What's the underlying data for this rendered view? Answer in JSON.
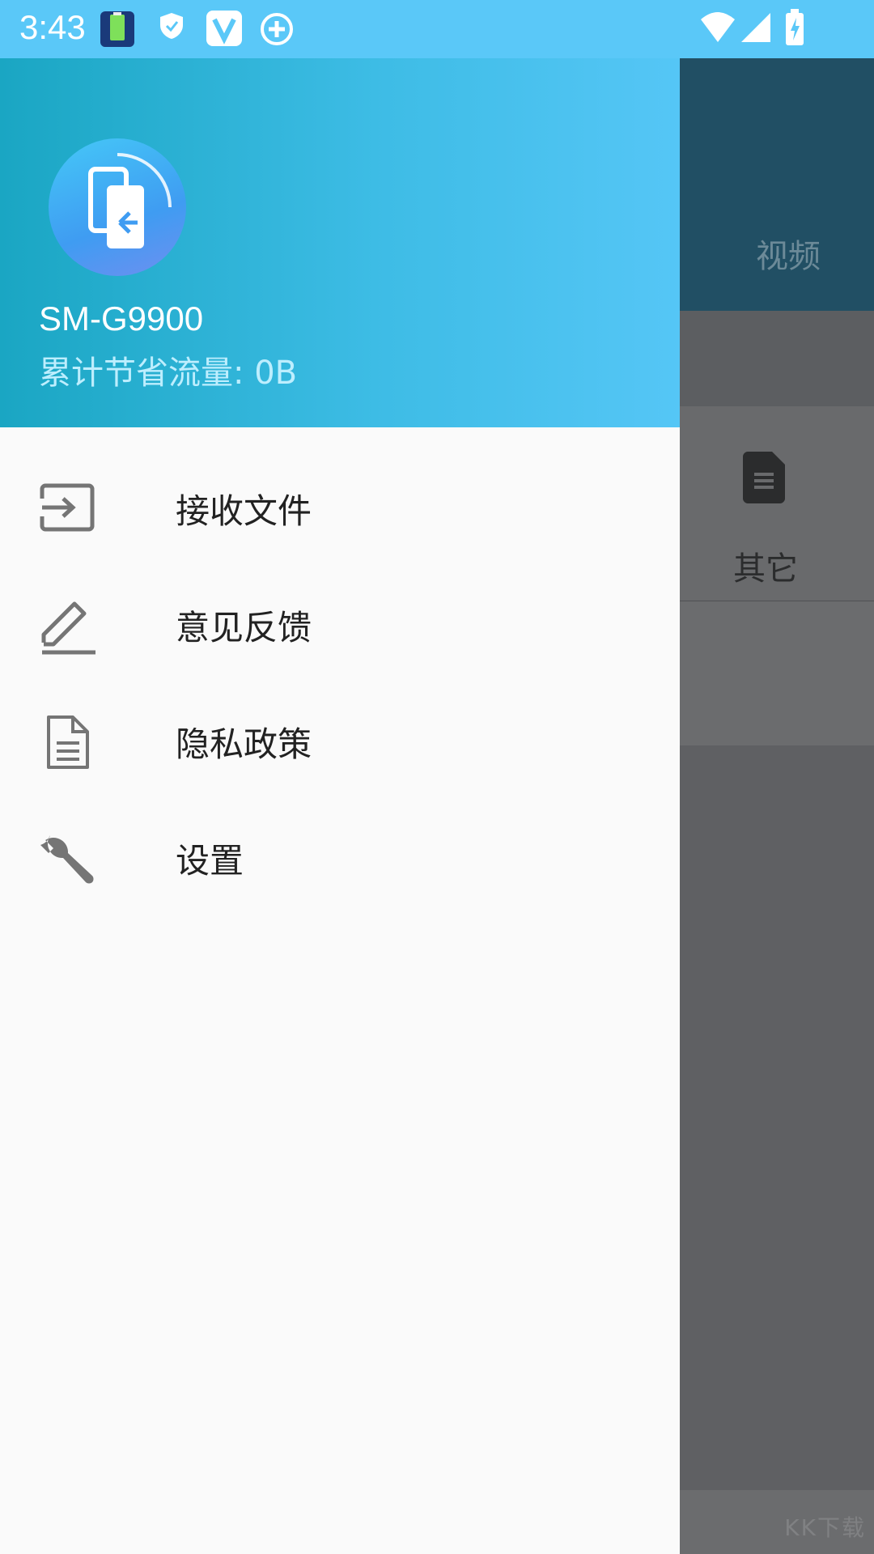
{
  "status_bar": {
    "time": "3:43",
    "left_icons": [
      "battery-app-icon",
      "shield-icon",
      "vivo-v-icon",
      "add-circle-icon"
    ],
    "right_icons": [
      "wifi-icon",
      "signal-icon",
      "battery-charging-icon"
    ]
  },
  "background_app": {
    "tab_label": "视频",
    "category_label": "其它",
    "category_icon": "document-icon",
    "watermark": "KK下载"
  },
  "drawer": {
    "device_name": "SM-G9900",
    "saved_traffic": "累计节省流量: 0B",
    "menu": [
      {
        "label": "接收文件",
        "icon": "receive-file-icon"
      },
      {
        "label": "意见反馈",
        "icon": "edit-pen-icon"
      },
      {
        "label": "隐私政策",
        "icon": "document-outline-icon"
      },
      {
        "label": "设置",
        "icon": "wrench-icon"
      }
    ]
  },
  "colors": {
    "status_bar": "#5ac8f8",
    "drawer_header_start": "#1aa6c3",
    "drawer_header_end": "#55c6f6",
    "background_header": "#214f64",
    "icon_gray": "#757575"
  }
}
